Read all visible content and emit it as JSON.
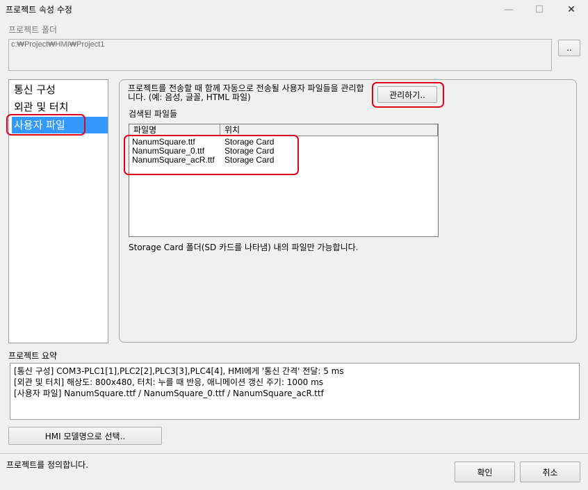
{
  "window": {
    "title": "프로젝트 속성 수정",
    "minimize_icon": "—",
    "maximize_icon": "☐",
    "close_icon": "✕"
  },
  "project_folder": {
    "label": "프로젝트 폴더",
    "path": "c:₩Project₩HMI₩Project1",
    "browse_label": ".."
  },
  "sidebar": {
    "items": [
      {
        "label": "통신 구성"
      },
      {
        "label": "외관 및 터치"
      },
      {
        "label": "사용자 파일"
      }
    ],
    "selected": "사용자 파일"
  },
  "user_files": {
    "description": "프로젝트를 전송할 때 함께 자동으로 전송될 사용자 파일들을 관리합니다. (예: 음성, 글꼴, HTML 파일)",
    "manage_button": "관리하기..",
    "found_label": "검색된 파일들",
    "columns": [
      "파일명",
      "위치"
    ],
    "rows": [
      {
        "name": "NanumSquare.ttf",
        "location": "Storage Card"
      },
      {
        "name": "NanumSquare_0.ttf",
        "location": "Storage Card"
      },
      {
        "name": "NanumSquare_acR.ttf",
        "location": "Storage Card"
      }
    ],
    "note": "Storage Card 폴더(SD 카드를 나타냄) 내의 파일만 가능합니다."
  },
  "summary": {
    "label": "프로젝트 요약",
    "lines": [
      "[통신 구성] COM3-PLC1[1],PLC2[2],PLC3[3],PLC4[4], HMI에게 '통신 간격' 전달: 5 ms",
      "[외관 및 터치]  해상도: 800x480,  터치: 누를 때 반응, 애니메이션 갱신 주기: 1000 ms",
      "[사용자 파일] NanumSquare.ttf / NanumSquare_0.ttf / NanumSquare_acR.ttf"
    ]
  },
  "select_model_button": "HMI 모델명으로 선택..",
  "status": {
    "text": "프로젝트를 정의합니다.",
    "ok_label": "확인",
    "cancel_label": "취소"
  },
  "colors": {
    "highlight": "#3399ff",
    "annotation_red": "#e0001b"
  }
}
